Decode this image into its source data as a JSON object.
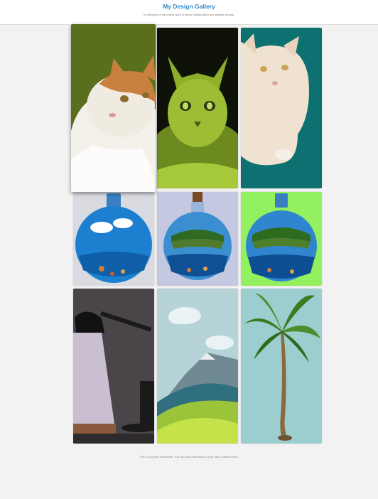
{
  "header": {
    "title": "My Design Gallery",
    "subtitle": "A collection of my recent work in photo manipulation and graphic design."
  },
  "gallery": {
    "items": [
      {
        "icon": "calico-cat-on-olive-background"
      },
      {
        "icon": "green-textured-cat"
      },
      {
        "icon": "cream-cat-on-teal-background"
      },
      {
        "icon": "bottle-with-underwater-reef-and-clouds"
      },
      {
        "icon": "bottle-with-island-and-reef-on-lavender"
      },
      {
        "icon": "bottle-with-island-and-reef-on-lime"
      },
      {
        "icon": "desk-lamp-scene"
      },
      {
        "icon": "hills-and-mountain-landscape"
      },
      {
        "icon": "palm-tree-on-light-teal"
      }
    ]
  },
  "footer": {
    "note": "This is a project showcase. You can add a link back to your main portfolio here."
  },
  "colors": {
    "accent": "#2f86c8",
    "page_bg": "#f2f2f2"
  }
}
